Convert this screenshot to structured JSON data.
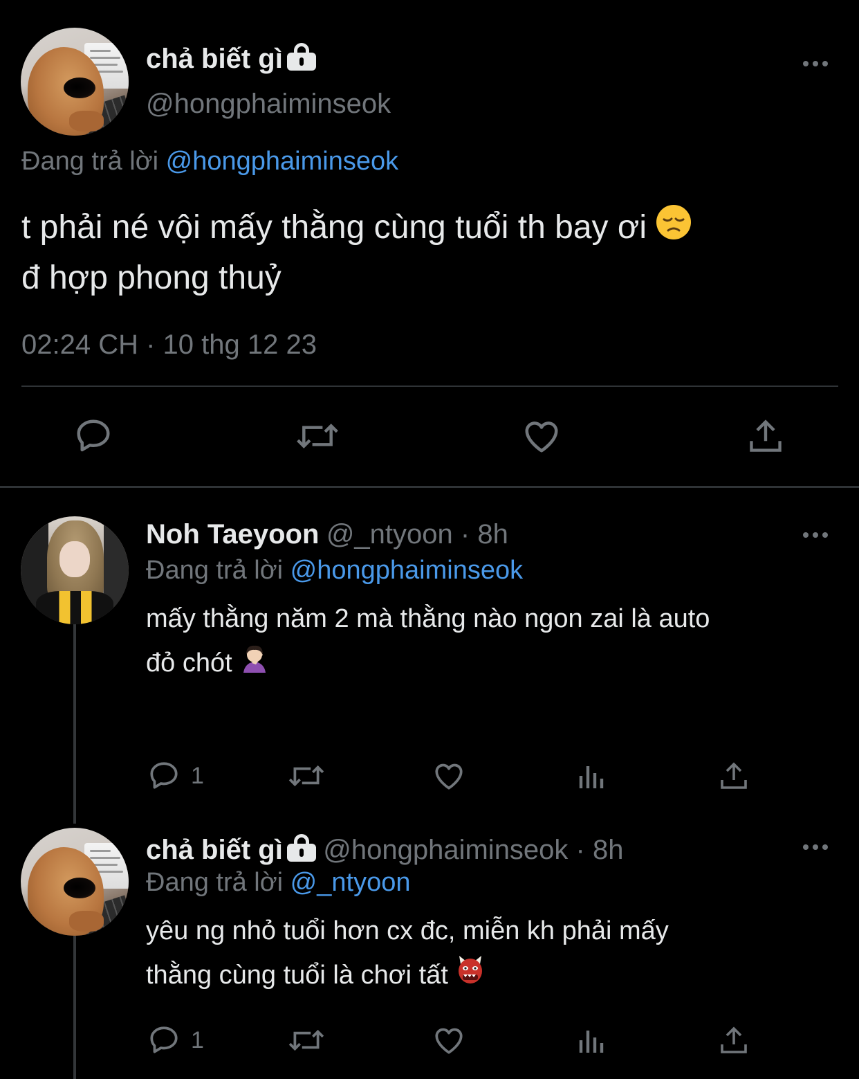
{
  "main_tweet": {
    "display_name": "chả biết gì",
    "handle": "@hongphaiminseok",
    "reply_prefix": "Đang trả lời",
    "reply_to": "@hongphaiminseok",
    "text_line1": "t phải né vội mấy thằng cùng tuổi th bay ơi",
    "text_line2": "đ hợp phong thuỷ",
    "timestamp": "02:24 CH · 10 thg 12 23",
    "lock_icon": "lock-icon",
    "more_icon": "more-icon",
    "actions": [
      "reply-icon",
      "retweet-icon",
      "like-icon",
      "share-icon"
    ]
  },
  "replies": [
    {
      "display_name": "Noh Taeyoon",
      "meta": "@_ntyoon · 8h",
      "reply_prefix": "Đang trả lời",
      "reply_to": "@hongphaiminseok",
      "text_line1": "mấy thằng năm 2 mà thằng nào ngon zai là auto",
      "text_line2": "đỏ chót",
      "reply_count": "1"
    },
    {
      "display_name": "chả biết gì",
      "meta": "@hongphaiminseok · 8h",
      "reply_prefix": "Đang trả lời",
      "reply_to": "@_ntyoon",
      "text_line1": "yêu ng nhỏ tuổi hơn cx đc, miễn kh phải mấy",
      "text_line2": "thằng cùng tuổi là chơi tất",
      "reply_count": "1"
    }
  ],
  "colors": {
    "background": "#000000",
    "text": "#e7e9ea",
    "muted": "#71767b",
    "link": "#4a99e9",
    "divider": "#2f3336"
  }
}
